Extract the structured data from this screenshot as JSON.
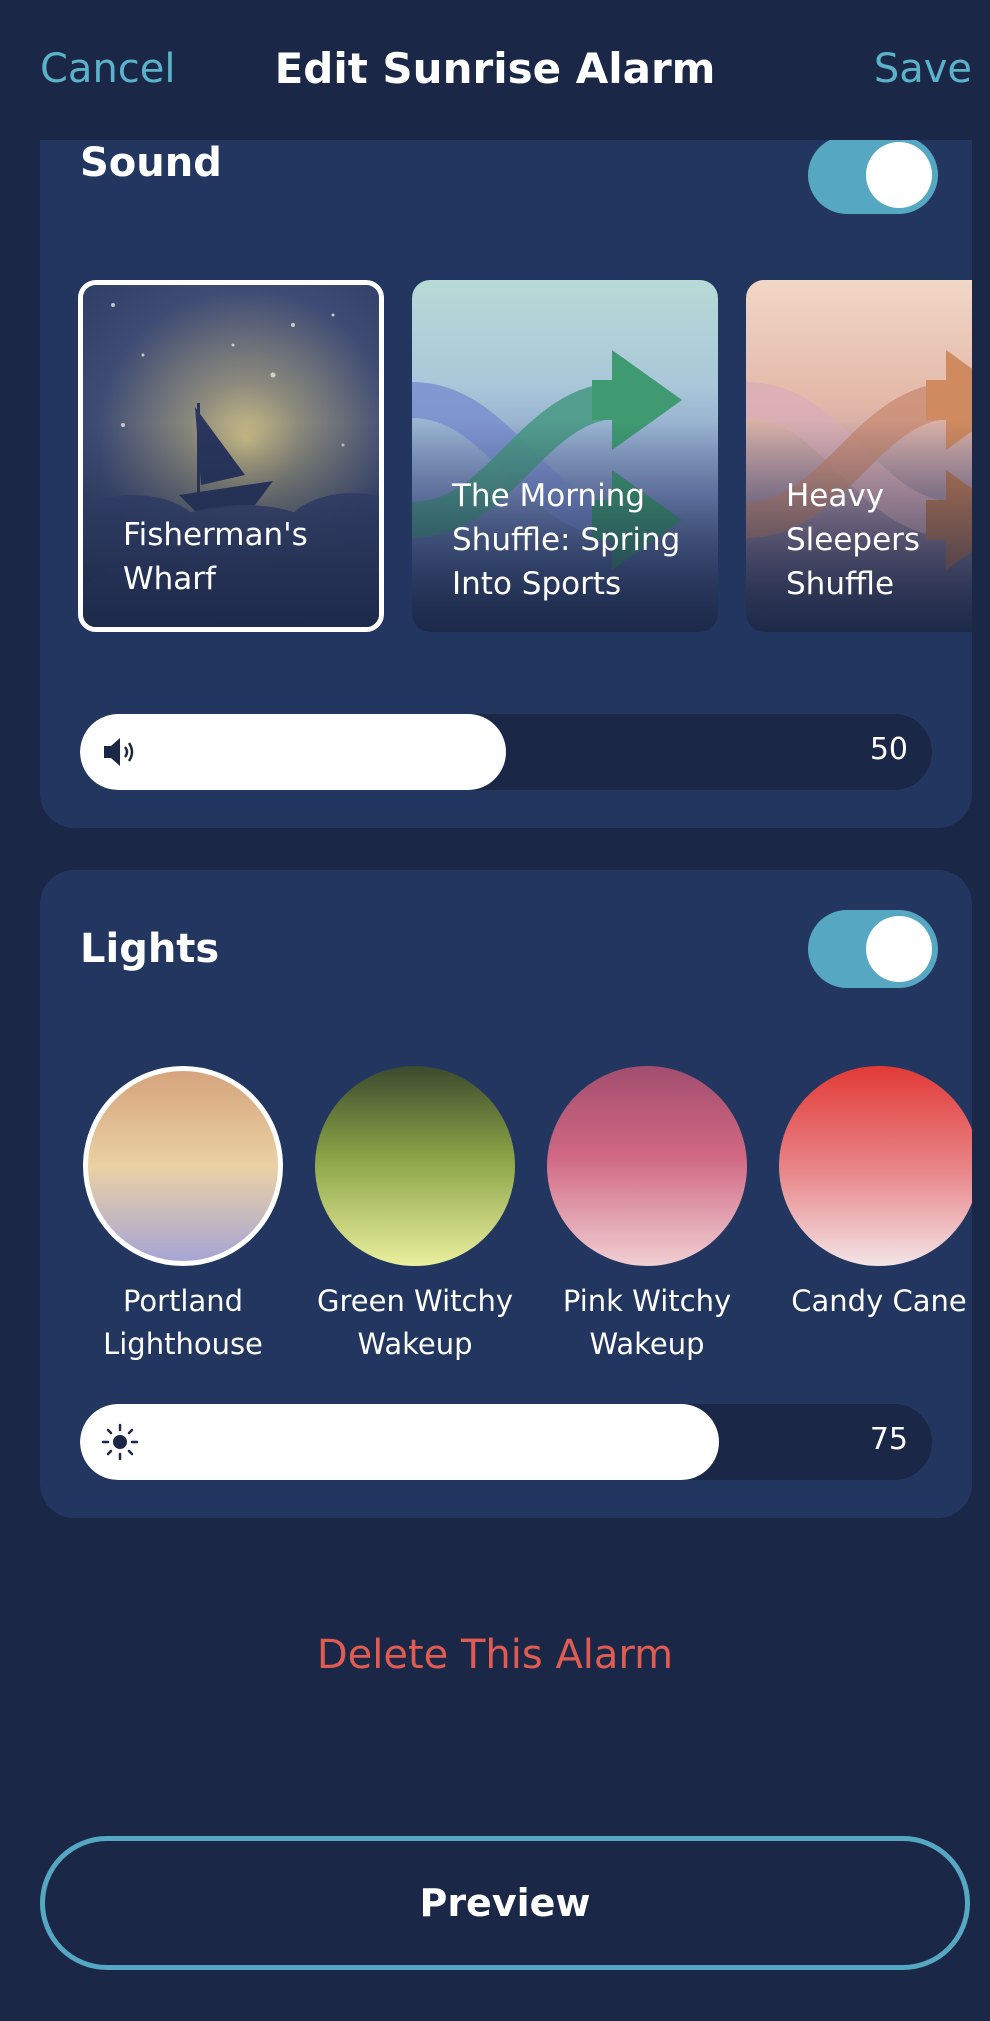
{
  "header": {
    "cancel_label": "Cancel",
    "title": "Edit Sunrise Alarm",
    "save_label": "Save"
  },
  "sound": {
    "title": "Sound",
    "toggle_on": true,
    "tracks": [
      {
        "label": "Fisherman's\nWharf",
        "selected": true
      },
      {
        "label": "The Morning\nShuffle: Spring\nInto Sports",
        "selected": false
      },
      {
        "label": "Heavy\nSleepers\nShuffle",
        "selected": false
      }
    ],
    "volume": {
      "icon": "speaker-icon",
      "value": "50",
      "level": 0.5
    }
  },
  "lights": {
    "title": "Lights",
    "toggle_on": true,
    "presets": [
      {
        "label": "Portland\nLighthouse",
        "selected": true
      },
      {
        "label": "Green Witchy\nWakeup",
        "selected": false
      },
      {
        "label": "Pink Witchy\nWakeup",
        "selected": false
      },
      {
        "label": "Candy Cane",
        "selected": false
      }
    ],
    "brightness": {
      "icon": "sun-icon",
      "value": "75",
      "level": 0.75
    }
  },
  "delete_label": "Delete This Alarm",
  "preview_label": "Preview",
  "colors": {
    "accent": "#56a8c2",
    "danger": "#e05c52",
    "background": "#1a2746",
    "card": "#22365f"
  }
}
